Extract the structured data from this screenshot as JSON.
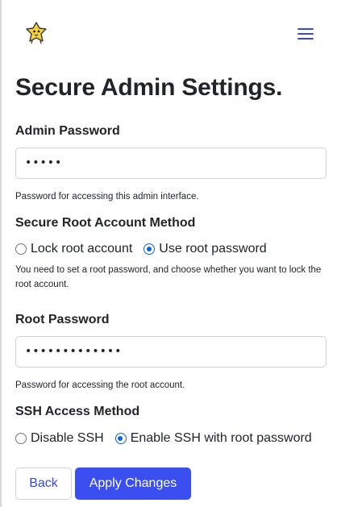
{
  "header": {
    "logo_icon": "yellow-star-mascot-icon",
    "menu_icon": "hamburger-menu-icon",
    "accent": "#3547f2"
  },
  "page": {
    "title": "Secure Admin Settings."
  },
  "admin_password": {
    "label": "Admin Password",
    "value": "•••••",
    "help": "Password for accessing this admin interface."
  },
  "root_method": {
    "label": "Secure Root Account Method",
    "options": [
      "Lock root account",
      "Use root password"
    ],
    "selected": "Use root password",
    "help": "You need to set a root password, and choose whether you want to lock the root account."
  },
  "root_password": {
    "label": "Root Password",
    "value": "•••••••••••••",
    "help": "Password for accessing the root account."
  },
  "ssh_method": {
    "label": "SSH Access Method",
    "options": [
      "Disable SSH",
      "Enable SSH with root password"
    ],
    "selected": "Enable SSH with root password"
  },
  "actions": {
    "back_label": "Back",
    "apply_label": "Apply Changes",
    "primary_color": "#3b4ef0"
  }
}
